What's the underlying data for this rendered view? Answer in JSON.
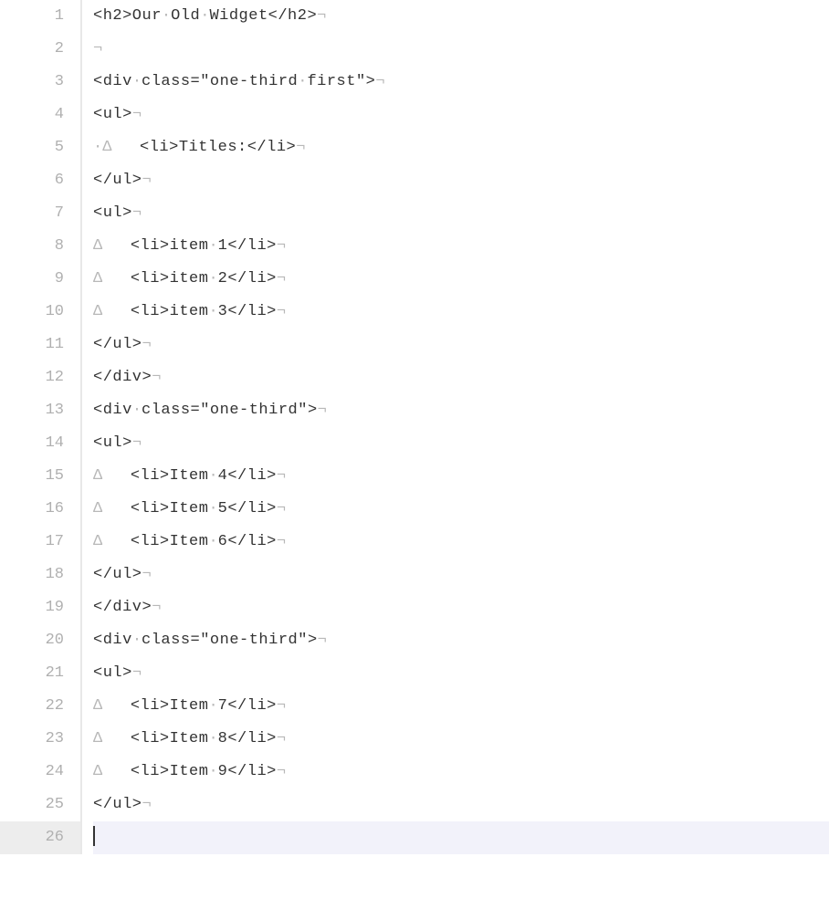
{
  "lines": [
    {
      "num": "1",
      "segments": [
        {
          "t": "<h2>Our"
        },
        {
          "t": "·",
          "ws": true
        },
        {
          "t": "Old"
        },
        {
          "t": "·",
          "ws": true
        },
        {
          "t": "Widget</h2>"
        },
        {
          "t": "¬",
          "ws": true
        }
      ]
    },
    {
      "num": "2",
      "segments": [
        {
          "t": "¬",
          "ws": true
        }
      ]
    },
    {
      "num": "3",
      "segments": [
        {
          "t": "<div"
        },
        {
          "t": "·",
          "ws": true
        },
        {
          "t": "class=\"one-third"
        },
        {
          "t": "·",
          "ws": true
        },
        {
          "t": "first\">"
        },
        {
          "t": "¬",
          "ws": true
        }
      ]
    },
    {
      "num": "4",
      "segments": [
        {
          "t": "<ul>"
        },
        {
          "t": "¬",
          "ws": true
        }
      ]
    },
    {
      "num": "5",
      "segments": [
        {
          "t": "·",
          "ws": true
        },
        {
          "t": "Δ   ",
          "ws": true
        },
        {
          "t": "<li>Titles:</li>"
        },
        {
          "t": "¬",
          "ws": true
        }
      ]
    },
    {
      "num": "6",
      "segments": [
        {
          "t": "</ul>"
        },
        {
          "t": "¬",
          "ws": true
        }
      ]
    },
    {
      "num": "7",
      "segments": [
        {
          "t": "<ul>"
        },
        {
          "t": "¬",
          "ws": true
        }
      ]
    },
    {
      "num": "8",
      "segments": [
        {
          "t": "Δ   ",
          "ws": true
        },
        {
          "t": "<li>item"
        },
        {
          "t": "·",
          "ws": true
        },
        {
          "t": "1</li>"
        },
        {
          "t": "¬",
          "ws": true
        }
      ]
    },
    {
      "num": "9",
      "segments": [
        {
          "t": "Δ   ",
          "ws": true
        },
        {
          "t": "<li>item"
        },
        {
          "t": "·",
          "ws": true
        },
        {
          "t": "2</li>"
        },
        {
          "t": "¬",
          "ws": true
        }
      ]
    },
    {
      "num": "10",
      "segments": [
        {
          "t": "Δ   ",
          "ws": true
        },
        {
          "t": "<li>item"
        },
        {
          "t": "·",
          "ws": true
        },
        {
          "t": "3</li>"
        },
        {
          "t": "¬",
          "ws": true
        }
      ]
    },
    {
      "num": "11",
      "segments": [
        {
          "t": "</ul>"
        },
        {
          "t": "¬",
          "ws": true
        }
      ]
    },
    {
      "num": "12",
      "segments": [
        {
          "t": "</div>"
        },
        {
          "t": "¬",
          "ws": true
        }
      ]
    },
    {
      "num": "13",
      "segments": [
        {
          "t": "<div"
        },
        {
          "t": "·",
          "ws": true
        },
        {
          "t": "class=\"one-third\">"
        },
        {
          "t": "¬",
          "ws": true
        }
      ]
    },
    {
      "num": "14",
      "segments": [
        {
          "t": "<ul>"
        },
        {
          "t": "¬",
          "ws": true
        }
      ]
    },
    {
      "num": "15",
      "segments": [
        {
          "t": "Δ   ",
          "ws": true
        },
        {
          "t": "<li>Item"
        },
        {
          "t": "·",
          "ws": true
        },
        {
          "t": "4</li>"
        },
        {
          "t": "¬",
          "ws": true
        }
      ]
    },
    {
      "num": "16",
      "segments": [
        {
          "t": "Δ   ",
          "ws": true
        },
        {
          "t": "<li>Item"
        },
        {
          "t": "·",
          "ws": true
        },
        {
          "t": "5</li>"
        },
        {
          "t": "¬",
          "ws": true
        }
      ]
    },
    {
      "num": "17",
      "segments": [
        {
          "t": "Δ   ",
          "ws": true
        },
        {
          "t": "<li>Item"
        },
        {
          "t": "·",
          "ws": true
        },
        {
          "t": "6</li>"
        },
        {
          "t": "¬",
          "ws": true
        }
      ]
    },
    {
      "num": "18",
      "segments": [
        {
          "t": "</ul>"
        },
        {
          "t": "¬",
          "ws": true
        }
      ]
    },
    {
      "num": "19",
      "segments": [
        {
          "t": "</div>"
        },
        {
          "t": "¬",
          "ws": true
        }
      ]
    },
    {
      "num": "20",
      "segments": [
        {
          "t": "<div"
        },
        {
          "t": "·",
          "ws": true
        },
        {
          "t": "class=\"one-third\">"
        },
        {
          "t": "¬",
          "ws": true
        }
      ]
    },
    {
      "num": "21",
      "segments": [
        {
          "t": "<ul>"
        },
        {
          "t": "¬",
          "ws": true
        }
      ]
    },
    {
      "num": "22",
      "segments": [
        {
          "t": "Δ   ",
          "ws": true
        },
        {
          "t": "<li>Item"
        },
        {
          "t": "·",
          "ws": true
        },
        {
          "t": "7</li>"
        },
        {
          "t": "¬",
          "ws": true
        }
      ]
    },
    {
      "num": "23",
      "segments": [
        {
          "t": "Δ   ",
          "ws": true
        },
        {
          "t": "<li>Item"
        },
        {
          "t": "·",
          "ws": true
        },
        {
          "t": "8</li>"
        },
        {
          "t": "¬",
          "ws": true
        }
      ]
    },
    {
      "num": "24",
      "segments": [
        {
          "t": "Δ   ",
          "ws": true
        },
        {
          "t": "<li>Item"
        },
        {
          "t": "·",
          "ws": true
        },
        {
          "t": "9</li>"
        },
        {
          "t": "¬",
          "ws": true
        }
      ]
    },
    {
      "num": "25",
      "segments": [
        {
          "t": "</ul>"
        },
        {
          "t": "¬",
          "ws": true
        }
      ]
    },
    {
      "num": "26",
      "segments": [],
      "current": true,
      "cursor": true
    }
  ]
}
